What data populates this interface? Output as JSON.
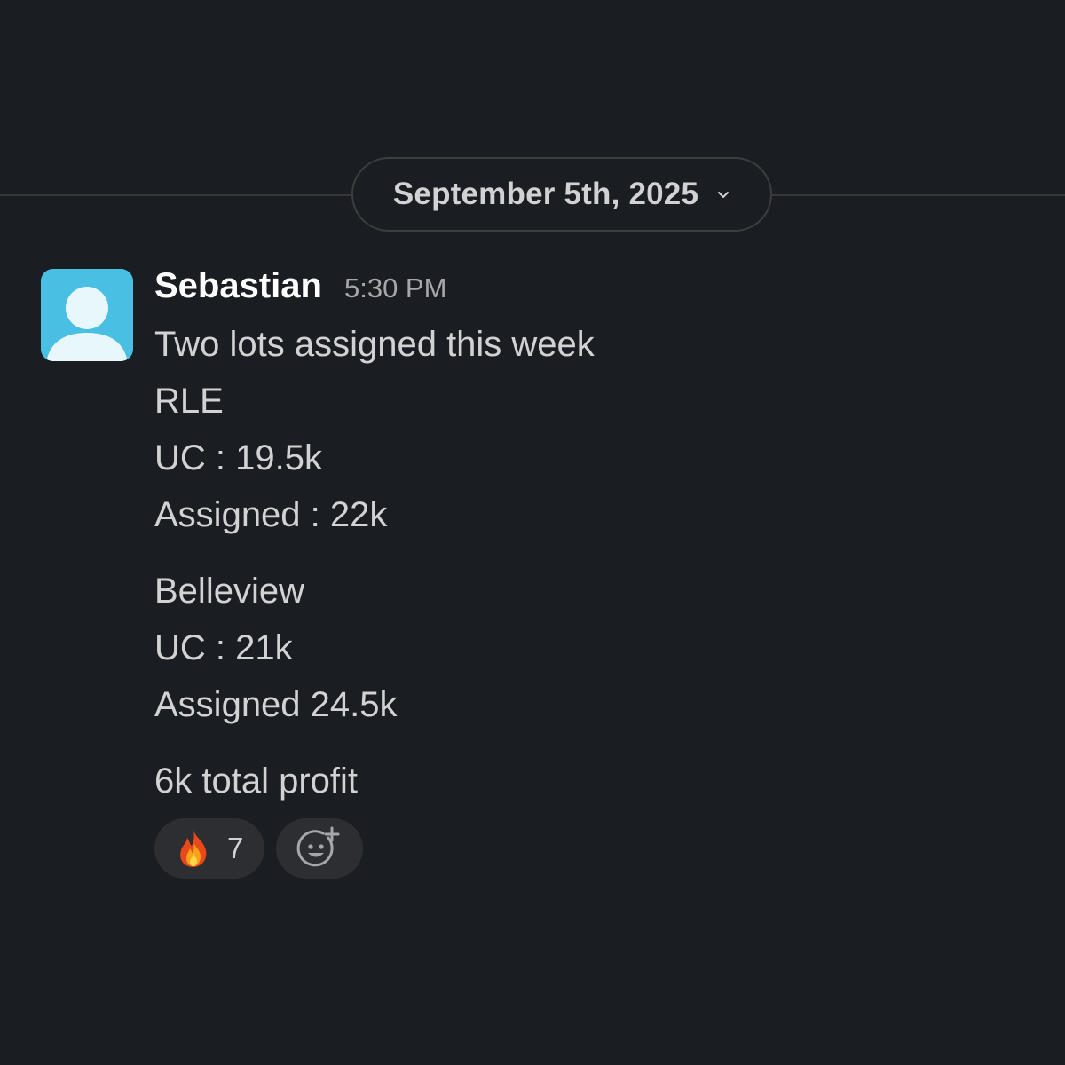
{
  "date_divider": {
    "label": "September 5th, 2025",
    "icon": "chevron-down-icon"
  },
  "message": {
    "avatar": {
      "icon": "default-user-avatar-icon",
      "color": "#48bfe3"
    },
    "sender": "Sebastian",
    "time": "5:30 PM",
    "lines": {
      "intro": "Two lots assigned this week",
      "lot1_name": "RLE",
      "lot1_uc": "UC : 19.5k",
      "lot1_assigned": "Assigned : 22k",
      "lot2_name": "Belleview",
      "lot2_uc": "UC : 21k",
      "lot2_assigned": "Assigned 24.5k",
      "summary": "6k total profit"
    },
    "reactions": [
      {
        "emoji": "fire-icon",
        "count": "7"
      }
    ],
    "add_reaction_icon": "add-reaction-icon"
  },
  "colors": {
    "background": "#1a1d21",
    "text": "#d1d2d3",
    "muted": "#a6a7a9",
    "reaction_bg": "#2c2e32"
  }
}
